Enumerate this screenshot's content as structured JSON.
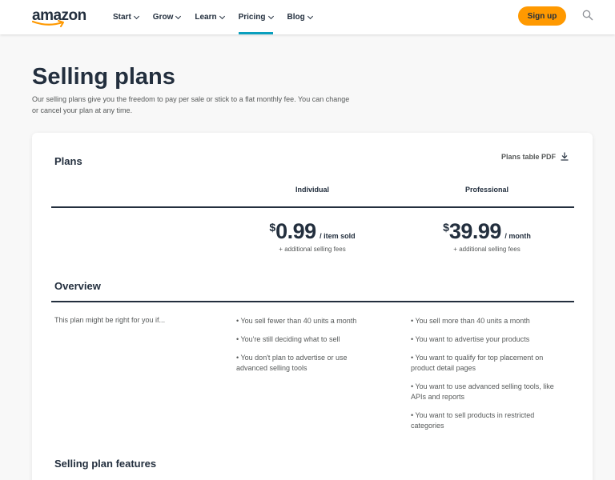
{
  "header": {
    "logo_text": "amazon",
    "nav": [
      {
        "label": "Start"
      },
      {
        "label": "Grow"
      },
      {
        "label": "Learn"
      },
      {
        "label": "Pricing"
      },
      {
        "label": "Blog"
      }
    ],
    "active_nav": "Pricing",
    "signup_label": "Sign up",
    "accent_color": "#ff9900",
    "active_color": "#0a9fbe",
    "search_icon": "search-icon"
  },
  "page": {
    "title": "Selling plans",
    "subtitle": "Our selling plans give you the freedom to pay per sale or stick to a flat monthly fee. You can change or cancel your plan at any time."
  },
  "plans": {
    "title": "Plans",
    "pdf_label": "Plans table PDF",
    "columns": [
      {
        "name": "Individual",
        "currency": "$",
        "amount": "0.99",
        "unit": "/ item sold",
        "note": "+ additional selling fees"
      },
      {
        "name": "Professional",
        "currency": "$",
        "amount": "39.99",
        "unit": "/ month",
        "note": "+ additional selling fees"
      }
    ]
  },
  "overview": {
    "title": "Overview",
    "lead": "This plan might be right for you if...",
    "individual": [
      "• You sell fewer than 40 units a month",
      "• You're still deciding what to sell",
      "• You don't plan to advertise or use advanced selling tools"
    ],
    "professional": [
      "• You sell more than 40 units a month",
      "• You want to advertise your products",
      "• You want to qualify for top placement on product detail pages",
      "• You want to use advanced selling tools, like APIs and reports",
      "• You want to sell products in restricted categories"
    ]
  },
  "features": {
    "title": "Selling plan features"
  }
}
